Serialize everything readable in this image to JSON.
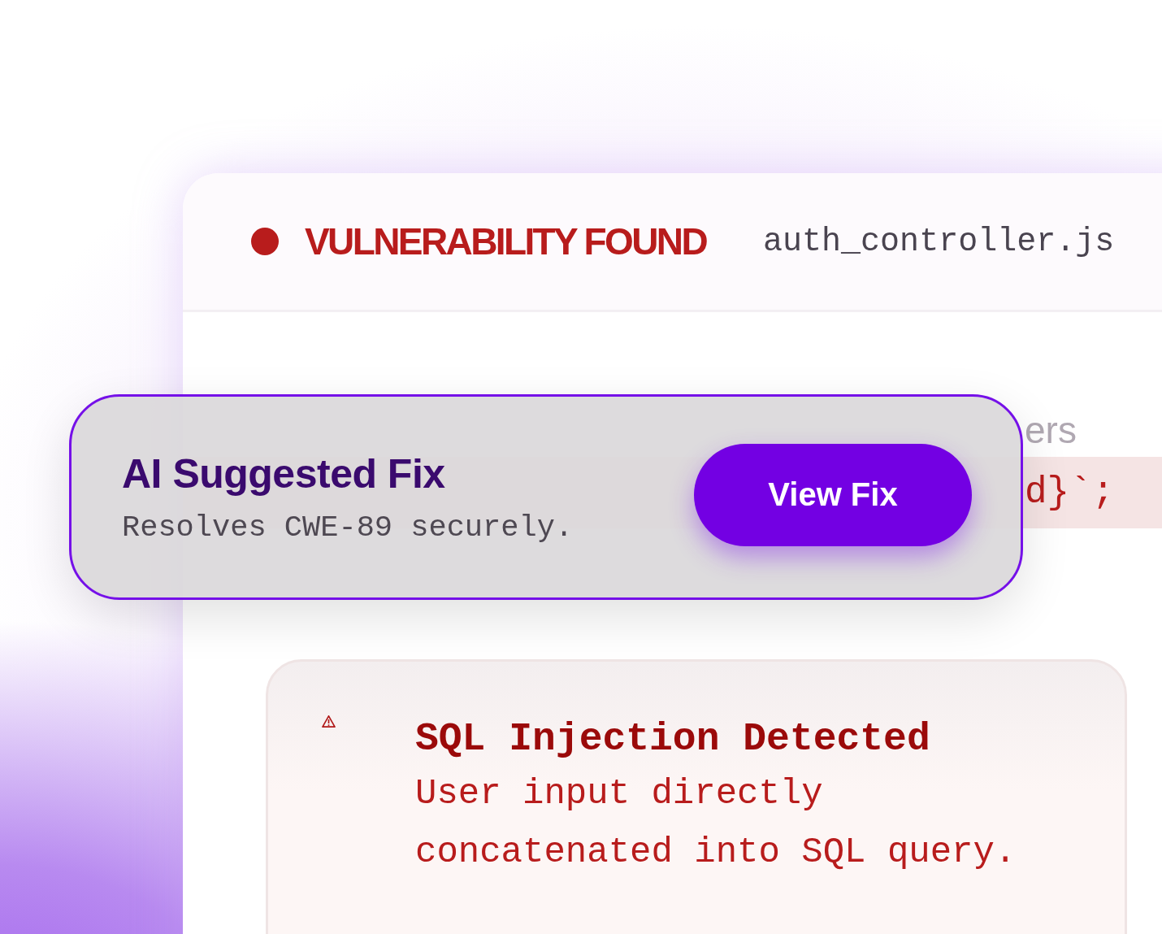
{
  "panel": {
    "status": "VULNERABILITY FOUND",
    "file": "auth_controller.js"
  },
  "code_lines": [
    {
      "text": "ers",
      "highlighted": false
    },
    {
      "text": "d}`;",
      "highlighted": true
    }
  ],
  "suggestion": {
    "title": "AI Suggested Fix",
    "subtitle": "Resolves CWE-89 securely.",
    "button": "View Fix"
  },
  "alert": {
    "title": "SQL Injection Detected",
    "lines": [
      "User input directly",
      "concatenated into SQL query."
    ]
  }
}
